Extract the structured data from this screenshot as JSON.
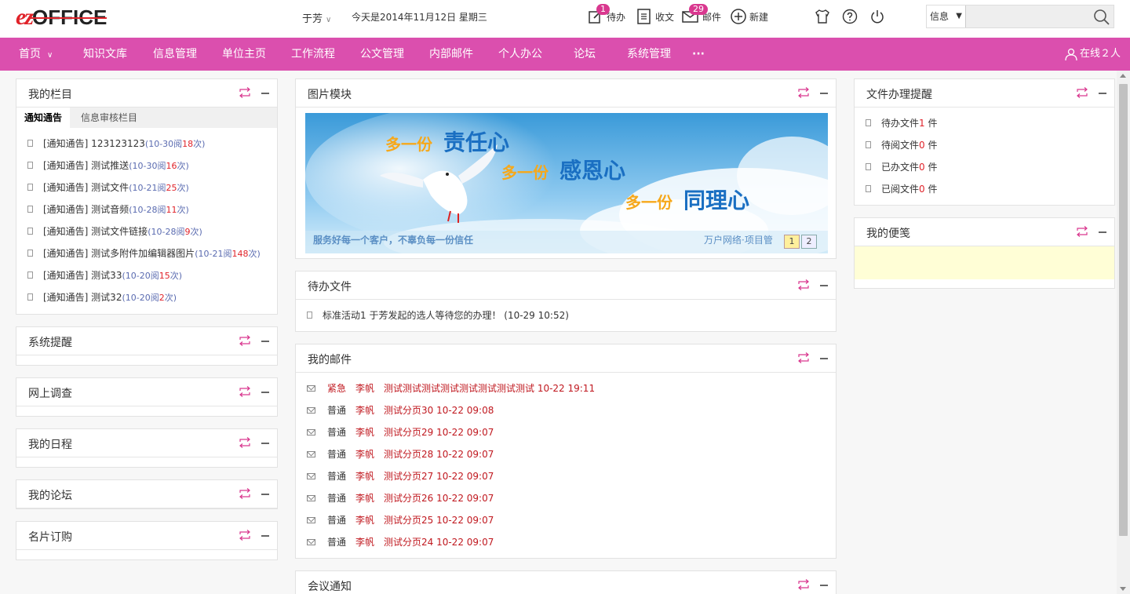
{
  "header": {
    "logo_ez": "ez",
    "logo_office": "OFFICE",
    "user_name": "于芳",
    "today": "今天是2014年11月12日  星期三",
    "todo_label": "待办",
    "todo_count": "1",
    "receive_doc_label": "收文",
    "mail_label": "邮件",
    "mail_count": "29",
    "new_label": "新建",
    "search_scope": "信息",
    "search_value": ""
  },
  "nav": {
    "items": [
      "首页",
      "知识文库",
      "信息管理",
      "单位主页",
      "工作流程",
      "公文管理",
      "内部邮件",
      "个人办公",
      "论坛",
      "系统管理"
    ],
    "more": "···",
    "online": "在线２人"
  },
  "left": {
    "my_column": {
      "title": "我的栏目",
      "tabs": [
        "通知通告",
        "信息审核栏目"
      ],
      "items": [
        {
          "text": "[通知通告] 123123123",
          "meta_pre": "(10-30阅",
          "count": "18",
          "meta_post": "次)"
        },
        {
          "text": "[通知通告] 测试推送",
          "meta_pre": "(10-30阅",
          "count": "16",
          "meta_post": "次)"
        },
        {
          "text": "[通知通告] 测试文件",
          "meta_pre": "(10-21阅",
          "count": "25",
          "meta_post": "次)"
        },
        {
          "text": "[通知通告] 测试音频",
          "meta_pre": "(10-28阅",
          "count": "11",
          "meta_post": "次)"
        },
        {
          "text": "[通知通告] 测试文件链接",
          "meta_pre": "(10-28阅",
          "count": "9",
          "meta_post": "次)"
        },
        {
          "text": "[通知通告] 测试多附件加编辑器图片",
          "meta_pre": "(10-21阅",
          "count": "148",
          "meta_post": "次)"
        },
        {
          "text": "[通知通告] 测试33",
          "meta_pre": "(10-20阅",
          "count": "15",
          "meta_post": "次)"
        },
        {
          "text": "[通知通告] 测试32",
          "meta_pre": "(10-20阅",
          "count": "2",
          "meta_post": "次)"
        }
      ]
    },
    "system_alert": {
      "title": "系统提醒"
    },
    "survey": {
      "title": "网上调查"
    },
    "schedule": {
      "title": "我的日程"
    },
    "forum": {
      "title": "我的论坛"
    },
    "card": {
      "title": "名片订购"
    }
  },
  "center": {
    "picture": {
      "title": "图片模块",
      "banner_line1_a": "多一份",
      "banner_line1_b": "责任心",
      "banner_line2_a": "多一份",
      "banner_line2_b": "感恩心",
      "banner_line3_a": "多一份",
      "banner_line3_b": "同理心",
      "banner_footer": "服务好每一个客户，不辜负每一份信任",
      "banner_right": "万户网络·项目管",
      "pages": [
        "1",
        "2"
      ]
    },
    "todo_docs": {
      "title": "待办文件",
      "items": [
        {
          "text": "标准活动1   于芳发起的选人等待您的办理！   (10-29 10:52)"
        }
      ]
    },
    "my_mail": {
      "title": "我的邮件",
      "rows": [
        {
          "level": "紧急",
          "from": "李帆",
          "subject": "测试测试测试测试测试测试测试测试  10-22 19:11"
        },
        {
          "level": "普通",
          "from": "李帆",
          "subject": "测试分页30  10-22 09:08"
        },
        {
          "level": "普通",
          "from": "李帆",
          "subject": "测试分页29  10-22 09:07"
        },
        {
          "level": "普通",
          "from": "李帆",
          "subject": "测试分页28  10-22 09:07"
        },
        {
          "level": "普通",
          "from": "李帆",
          "subject": "测试分页27  10-22 09:07"
        },
        {
          "level": "普通",
          "from": "李帆",
          "subject": "测试分页26  10-22 09:07"
        },
        {
          "level": "普通",
          "from": "李帆",
          "subject": "测试分页25  10-22 09:07"
        },
        {
          "level": "普通",
          "from": "李帆",
          "subject": "测试分页24  10-22 09:07"
        }
      ]
    },
    "meeting": {
      "title": "会议通知"
    }
  },
  "right": {
    "file_reminder": {
      "title": "文件办理提醒",
      "items": [
        {
          "label": "待办文件",
          "count": "1",
          "unit": " 件"
        },
        {
          "label": "待阅文件",
          "count": "0",
          "unit": " 件"
        },
        {
          "label": "已办文件",
          "count": "0",
          "unit": " 件"
        },
        {
          "label": "已阅文件",
          "count": "0",
          "unit": " 件"
        }
      ]
    },
    "notes": {
      "title": "我的便笺"
    }
  },
  "colors": {
    "brand": "#db4fae",
    "accent_red": "#c0181f",
    "meta_blue": "#5a6bb0"
  }
}
